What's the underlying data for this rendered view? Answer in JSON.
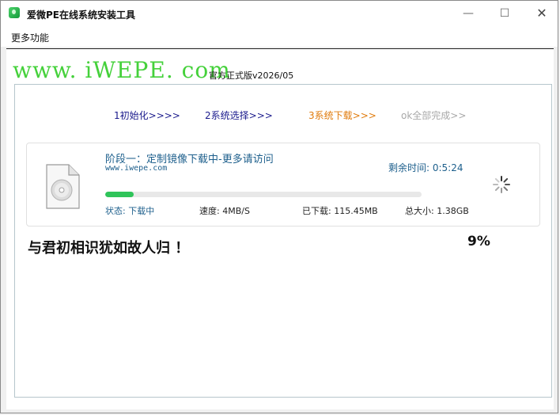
{
  "window": {
    "title": "爱微PE在线系统安装工具",
    "controls": {
      "minimize": "—",
      "maximize": "☐",
      "close": "✕"
    }
  },
  "menubar": {
    "items": [
      {
        "label": "更多功能"
      }
    ]
  },
  "header": {
    "logo_text": "www. iWEPE. com",
    "version": "官方正式版v2026/05"
  },
  "steps": [
    {
      "label": "1初始化>>>>",
      "state": "done"
    },
    {
      "label": "2系统选择>>>",
      "state": "done"
    },
    {
      "label": "3系统下载>>>",
      "state": "active"
    },
    {
      "label": "ok全部完成>>",
      "state": "pending"
    }
  ],
  "download": {
    "stage_title": "阶段一：定制镜像下载中-更多请访问",
    "stage_url": "www.iwepe.com",
    "remaining": "剩余时间: 0:5:24",
    "progress": 0.09,
    "status": "状态: 下载中",
    "speed": "速度: 4MB/S",
    "downloaded": "已下载: 115.45MB",
    "total": "总大小: 1.38GB",
    "file_icon": "disc-file-icon",
    "spinner_icon": "loading-spinner-icon"
  },
  "footer": {
    "slogan": "与君初相识犹如故人归 ！",
    "percent": "9%"
  },
  "colors": {
    "logo": "#45d13b",
    "progress": "#2fc45a",
    "step_done": "#1a1a8c",
    "step_active": "#e07b0c",
    "step_pending": "#a8a8a8",
    "info_text": "#1d5f8c"
  }
}
